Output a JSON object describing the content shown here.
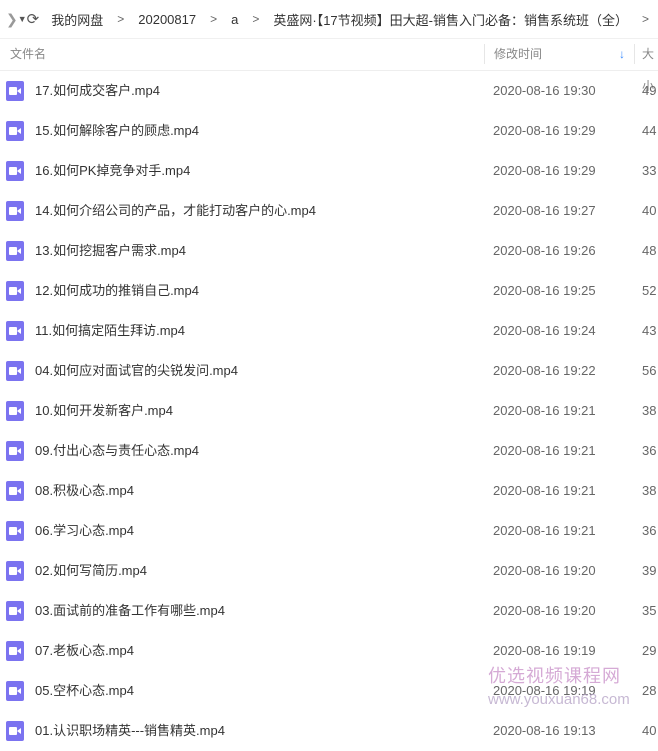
{
  "toolbar": {
    "forward_icon": "chevron-right-icon",
    "dropdown_icon": "caret-down-icon",
    "refresh_icon": "refresh-icon",
    "breadcrumb": [
      "我的网盘",
      "20200817",
      "a",
      "英盛网·【17节视频】田大超-销售入门必备：销售系统班（全）"
    ]
  },
  "columns": {
    "name": "文件名",
    "time": "修改时间",
    "size": "大小"
  },
  "colors": {
    "video_icon": "#7b73f0",
    "sort_arrow": "#3b8cff"
  },
  "files": [
    {
      "name": "17.如何成交客户.mp4",
      "time": "2020-08-16 19:30",
      "size": "49"
    },
    {
      "name": "15.如何解除客户的顾虑.mp4",
      "time": "2020-08-16 19:29",
      "size": "44"
    },
    {
      "name": "16.如何PK掉竞争对手.mp4",
      "time": "2020-08-16 19:29",
      "size": "33"
    },
    {
      "name": "14.如何介绍公司的产品，才能打动客户的心.mp4",
      "time": "2020-08-16 19:27",
      "size": "40"
    },
    {
      "name": "13.如何挖掘客户需求.mp4",
      "time": "2020-08-16 19:26",
      "size": "48"
    },
    {
      "name": "12.如何成功的推销自己.mp4",
      "time": "2020-08-16 19:25",
      "size": "52"
    },
    {
      "name": "11.如何搞定陌生拜访.mp4",
      "time": "2020-08-16 19:24",
      "size": "43"
    },
    {
      "name": "04.如何应对面试官的尖锐发问.mp4",
      "time": "2020-08-16 19:22",
      "size": "56"
    },
    {
      "name": "10.如何开发新客户.mp4",
      "time": "2020-08-16 19:21",
      "size": "38"
    },
    {
      "name": "09.付出心态与责任心态.mp4",
      "time": "2020-08-16 19:21",
      "size": "36"
    },
    {
      "name": "08.积极心态.mp4",
      "time": "2020-08-16 19:21",
      "size": "38"
    },
    {
      "name": "06.学习心态.mp4",
      "time": "2020-08-16 19:21",
      "size": "36"
    },
    {
      "name": "02.如何写简历.mp4",
      "time": "2020-08-16 19:20",
      "size": "39"
    },
    {
      "name": "03.面试前的准备工作有哪些.mp4",
      "time": "2020-08-16 19:20",
      "size": "35"
    },
    {
      "name": "07.老板心态.mp4",
      "time": "2020-08-16 19:19",
      "size": "29"
    },
    {
      "name": "05.空杯心态.mp4",
      "time": "2020-08-16 19:19",
      "size": "28"
    },
    {
      "name": "01.认识职场精英---销售精英.mp4",
      "time": "2020-08-16 19:13",
      "size": "40"
    }
  ],
  "watermark": {
    "text": "优选视频课程网",
    "url": "www.youxuan68.com"
  }
}
